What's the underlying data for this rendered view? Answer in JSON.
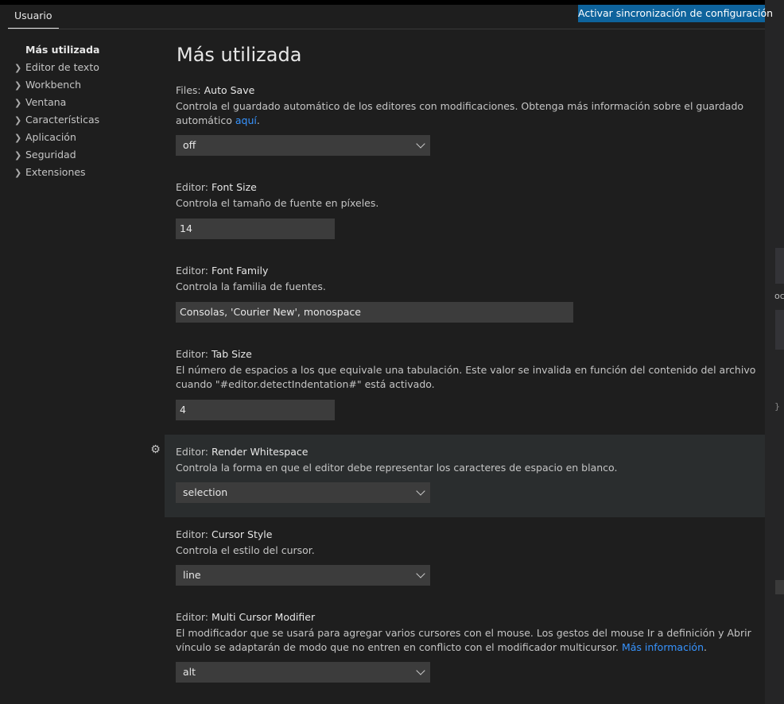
{
  "tabs": {
    "user": "Usuario"
  },
  "sync_button": "Activar sincronización de configuración",
  "toc": {
    "active": "Más utilizada",
    "items": [
      "Editor de texto",
      "Workbench",
      "Ventana",
      "Características",
      "Aplicación",
      "Seguridad",
      "Extensiones"
    ]
  },
  "main": {
    "heading": "Más utilizada",
    "settings": [
      {
        "category": "Files: ",
        "name": "Auto Save",
        "description": "Controla el guardado automático de los editores con modificaciones. Obtenga más información sobre el guardado automático ",
        "link": "aquí",
        "after_link": ".",
        "value": "off"
      },
      {
        "category": "Editor: ",
        "name": "Font Size",
        "description": "Controla el tamaño de fuente en píxeles.",
        "value": "14"
      },
      {
        "category": "Editor: ",
        "name": "Font Family",
        "description": "Controla la familia de fuentes.",
        "value": "Consolas, 'Courier New', monospace"
      },
      {
        "category": "Editor: ",
        "name": "Tab Size",
        "description": "El número de espacios a los que equivale una tabulación. Este valor se invalida en función del contenido del archivo cuando \"#editor.detectIndentation#\" está activado.",
        "value": "4"
      },
      {
        "category": "Editor: ",
        "name": "Render Whitespace",
        "description": "Controla la forma en que el editor debe representar los caracteres de espacio en blanco.",
        "value": "selection"
      },
      {
        "category": "Editor: ",
        "name": "Cursor Style",
        "description": "Controla el estilo del cursor.",
        "value": "line"
      },
      {
        "category": "Editor: ",
        "name": "Multi Cursor Modifier",
        "description": "El modificador que se usará para agregar varios cursores con el mouse. Los gestos del mouse Ir a definición y Abrir vínculo se adaptarán de modo que no entren en conflicto con el modificador multicursor. ",
        "link": "Más información",
        "after_link": ".",
        "value": "alt"
      }
    ]
  },
  "edge_fragments": {
    "a": "oc",
    "b": "}"
  },
  "colors": {
    "accent": "#0e639c",
    "link": "#3794ff",
    "background": "#1e1e1e",
    "input": "#3c3c3c"
  },
  "icons": {
    "chevron": "chevron-right-icon",
    "gear": "gear-icon",
    "dropdown": "chevron-down-icon"
  }
}
